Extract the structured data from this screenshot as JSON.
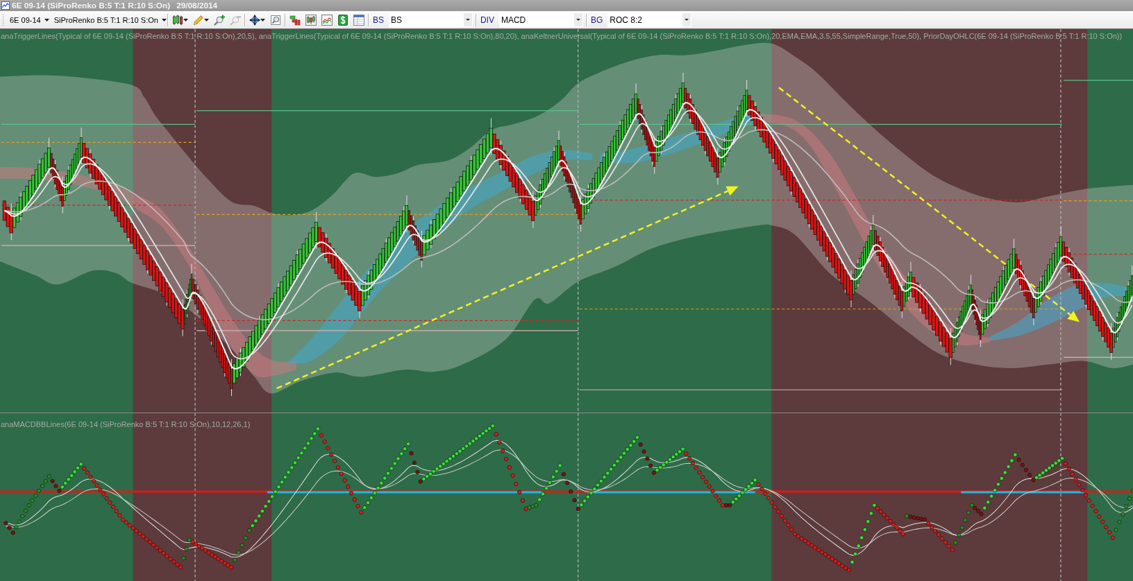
{
  "window": {
    "title": "6E 09-14 (SiProRenko B:5 T:1 R:10 S:On)",
    "date": "29/08/2014"
  },
  "toolbar": {
    "instrument": "6E 09-14",
    "chart_type": "SiProRenko B:5 T:1 R:10 S:On",
    "tool_groups": [
      [
        {
          "kind": "bar-style",
          "menu": true,
          "disabled": false
        },
        {
          "kind": "pencil",
          "menu": true,
          "disabled": false
        },
        {
          "kind": "zoom-in",
          "menu": false,
          "disabled": false
        },
        {
          "kind": "zoom-out",
          "menu": false,
          "disabled": true
        }
      ],
      [
        {
          "kind": "crosshair",
          "menu": true,
          "disabled": false
        },
        {
          "kind": "magnifier",
          "menu": false,
          "disabled": false
        }
      ],
      [
        {
          "kind": "data-box",
          "menu": false,
          "disabled": false
        },
        {
          "kind": "candles",
          "menu": false,
          "disabled": false
        },
        {
          "kind": "line-chart",
          "menu": false,
          "disabled": false
        },
        {
          "kind": "dollar",
          "menu": false,
          "disabled": false
        },
        {
          "kind": "table",
          "menu": false,
          "disabled": false
        }
      ]
    ],
    "selectors": [
      {
        "label": "BS",
        "value": "BS"
      },
      {
        "label": "DIV",
        "value": "MACD"
      },
      {
        "label": "BG",
        "value": "ROC 8:2"
      }
    ]
  },
  "price_panel": {
    "indicators": "anaTriggerLines(Typical of 6E 09-14 (SiProRenko B:5 T:1 R:10 S:On),20,5), anaTriggerLines(Typical of 6E 09-14 (SiProRenko B:5 T:1 R:10 S:On),80,20), anaKeltnerUniversal(Typical of 6E 09-14 (SiProRenko B:5 T:1 R:10 S:On),20,EMA,EMA,3.5,55,SimpleRange,True,50), PriorDayOHLC(6E 09-14 (SiProRenko B:5 T:1 R:10 S:On))"
  },
  "macd_panel": {
    "indicators": "anaMACDBBLines(6E 09-14 (SiProRenko B:5 T:1 R:10 S:On),10,12,26,1)"
  }
}
